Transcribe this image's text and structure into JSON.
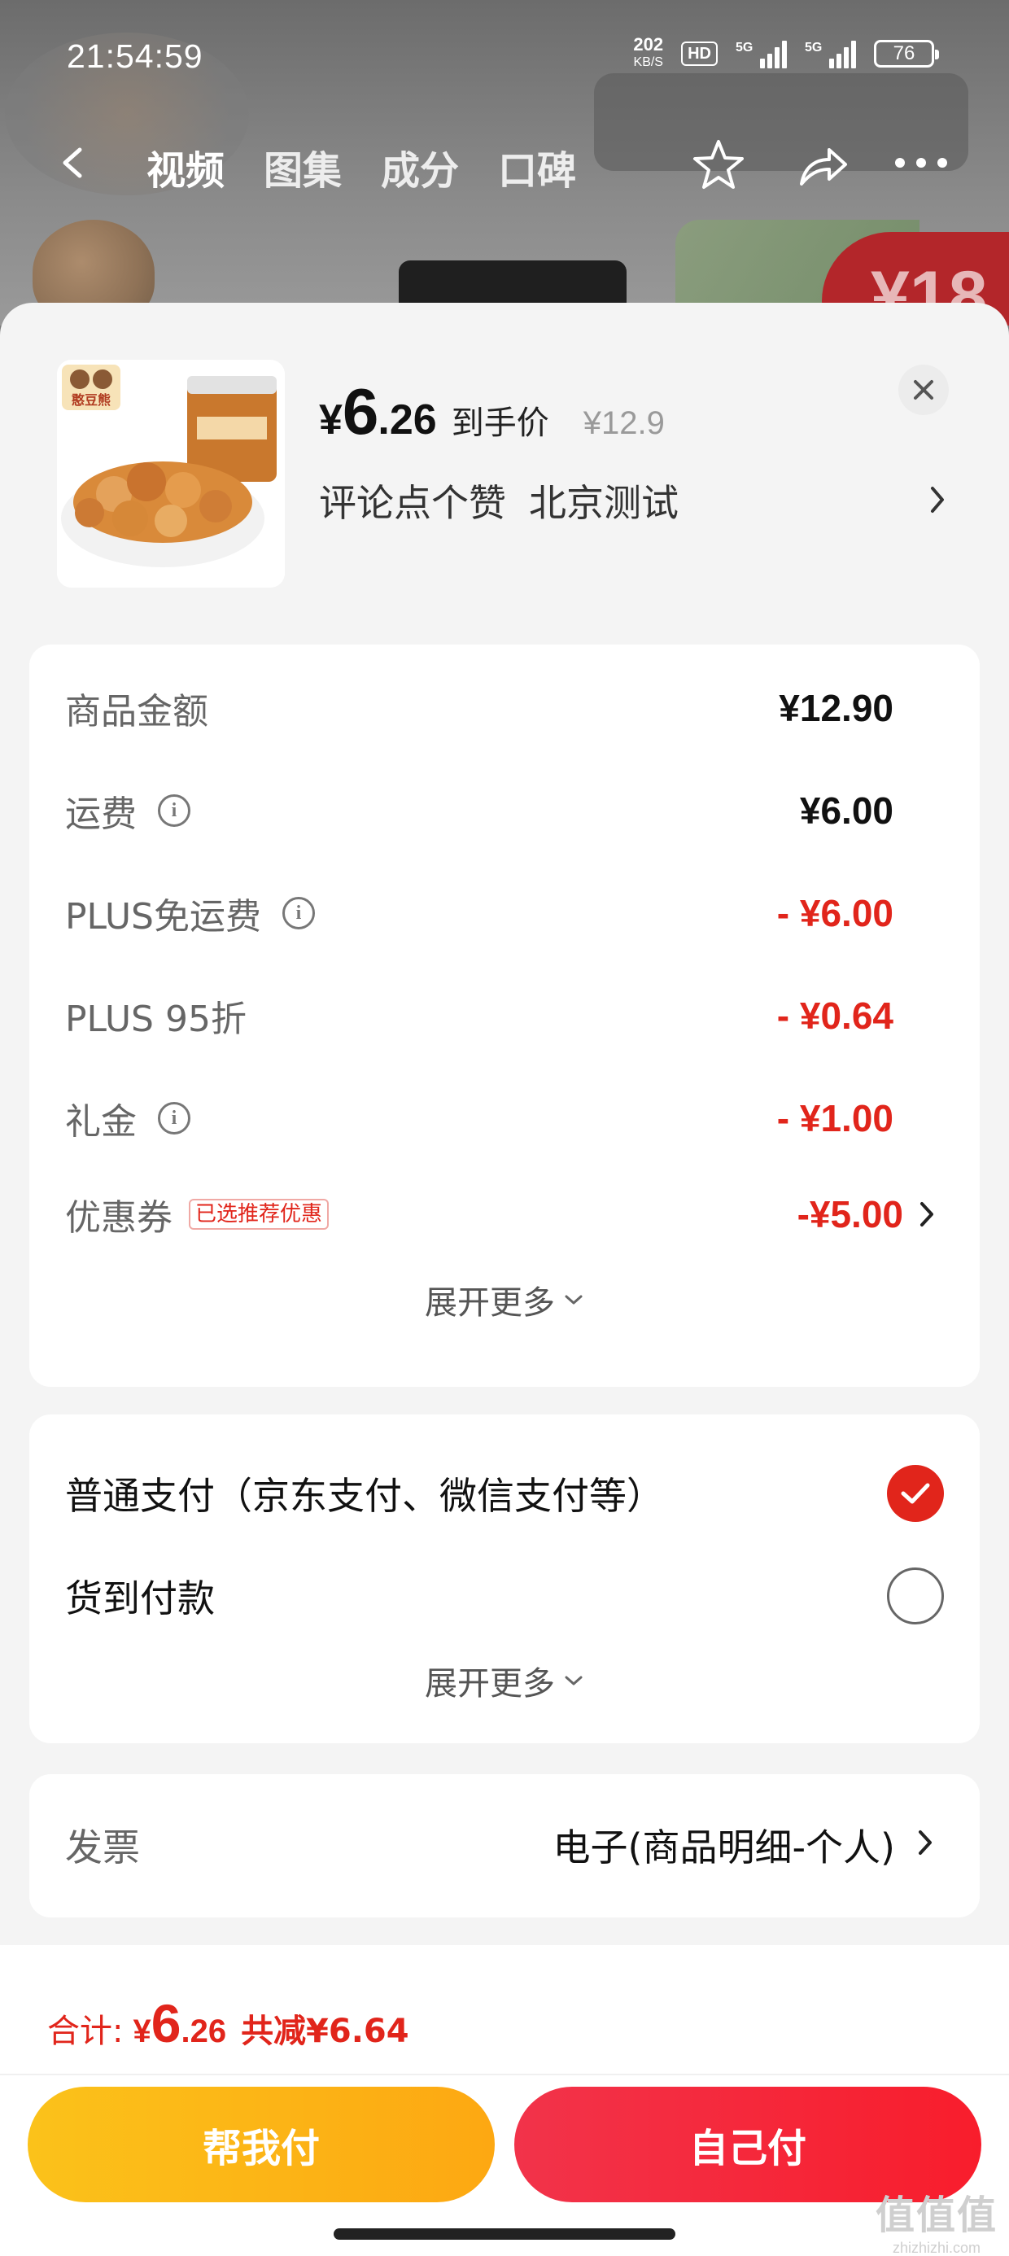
{
  "status_bar": {
    "time": "21:54:59",
    "net_speed": "202",
    "net_unit": "KB/S",
    "hd_label": "HD",
    "signal1_label": "5G",
    "signal2_label": "5G",
    "battery": "76"
  },
  "nav": {
    "tabs": [
      "视频",
      "图集",
      "成分",
      "口碑"
    ],
    "active_tab": "视频"
  },
  "background": {
    "badge_text": "¥18"
  },
  "product": {
    "price_symbol": "¥",
    "price_int": "6",
    "price_dec": ".26",
    "price_tag": "到手价",
    "original_price": "¥12.9",
    "spec": [
      "评论点个赞",
      "北京测试"
    ],
    "thumb_brand": "憨豆熊"
  },
  "costs": {
    "rows": [
      {
        "label": "商品金额",
        "value": "¥12.90",
        "info": false,
        "highlight": false
      },
      {
        "label": "运费",
        "value": "¥6.00",
        "info": true,
        "highlight": false
      },
      {
        "label": "PLUS免运费",
        "value": "- ¥6.00",
        "info": true,
        "highlight": true
      },
      {
        "label": "PLUS 95折",
        "value": "- ¥0.64",
        "info": false,
        "highlight": true
      },
      {
        "label": "礼金",
        "value": "- ¥1.00",
        "info": true,
        "highlight": true
      },
      {
        "label": "优惠券",
        "value": "-¥5.00",
        "info": false,
        "highlight": true
      }
    ],
    "coupon_tag": "已选推荐优惠",
    "expand_label": "展开更多"
  },
  "payment": {
    "options": [
      {
        "label": "普通支付（京东支付、微信支付等）",
        "selected": true
      },
      {
        "label": "货到付款",
        "selected": false
      }
    ],
    "expand_label": "展开更多"
  },
  "invoice": {
    "label": "发票",
    "value": "电子(商品明细-个人)"
  },
  "total": {
    "label": "合计:",
    "yen": "¥",
    "int": "6",
    "dec": ".26",
    "reduce": "共减¥6.64"
  },
  "buttons": {
    "help_pay": "帮我付",
    "self_pay": "自己付"
  },
  "watermark": {
    "big": "值值值",
    "small": "zhizhizhi.com"
  },
  "colors": {
    "accent_red": "#e1251b",
    "button_yellow": "#fbc21a",
    "button_red": "#f2334a"
  }
}
